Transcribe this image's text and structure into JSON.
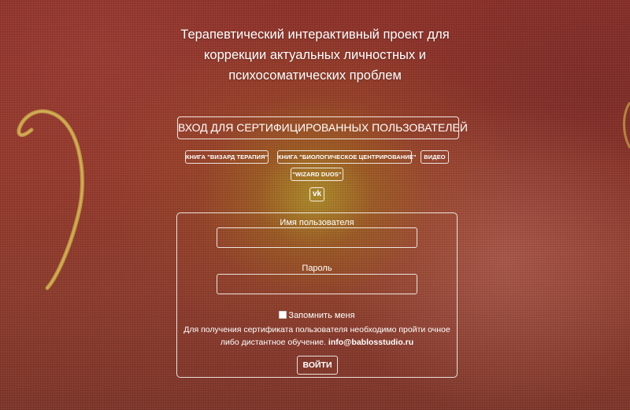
{
  "header": {
    "title_line1": "Терапевтический интерактивный проект для",
    "title_line2": "коррекции актуальных личностных и",
    "title_line3": "психосоматических проблем"
  },
  "nav": {
    "certified_login": "ВХОД ДЛЯ СЕРТИФИЦИРОВАННЫХ ПОЛЬЗОВАТЕЛЕЙ",
    "links": [
      {
        "label": "КНИГА \"ВИЗАРД ТЕРАПИЯ\""
      },
      {
        "label": "КНИГА \"БИОЛОГИЧЕСКОЕ ЦЕНТРИРОВАНИЕ\""
      },
      {
        "label": "ВИДЕО"
      },
      {
        "label": "\"WIZARD DUOS\""
      }
    ],
    "vk_label": "vk"
  },
  "login_form": {
    "username_label": "Имя пользователя",
    "username_value": "",
    "password_label": "Пароль",
    "password_value": "",
    "remember_label": "Запомнить меня",
    "remember_checked": false,
    "info_text": "Для получения сертификата пользователя необходимо пройти очное либо дистантное обучение.",
    "email": "info@bablosstudio.ru",
    "submit_label": "ВОЙТИ"
  },
  "colors": {
    "background": "#8d3028",
    "glow": "#af9628",
    "text": "#ffffff",
    "swirl": "#c9a64a"
  },
  "icons": {
    "vk": "vk-icon",
    "checkbox": "checkbox-icon"
  }
}
